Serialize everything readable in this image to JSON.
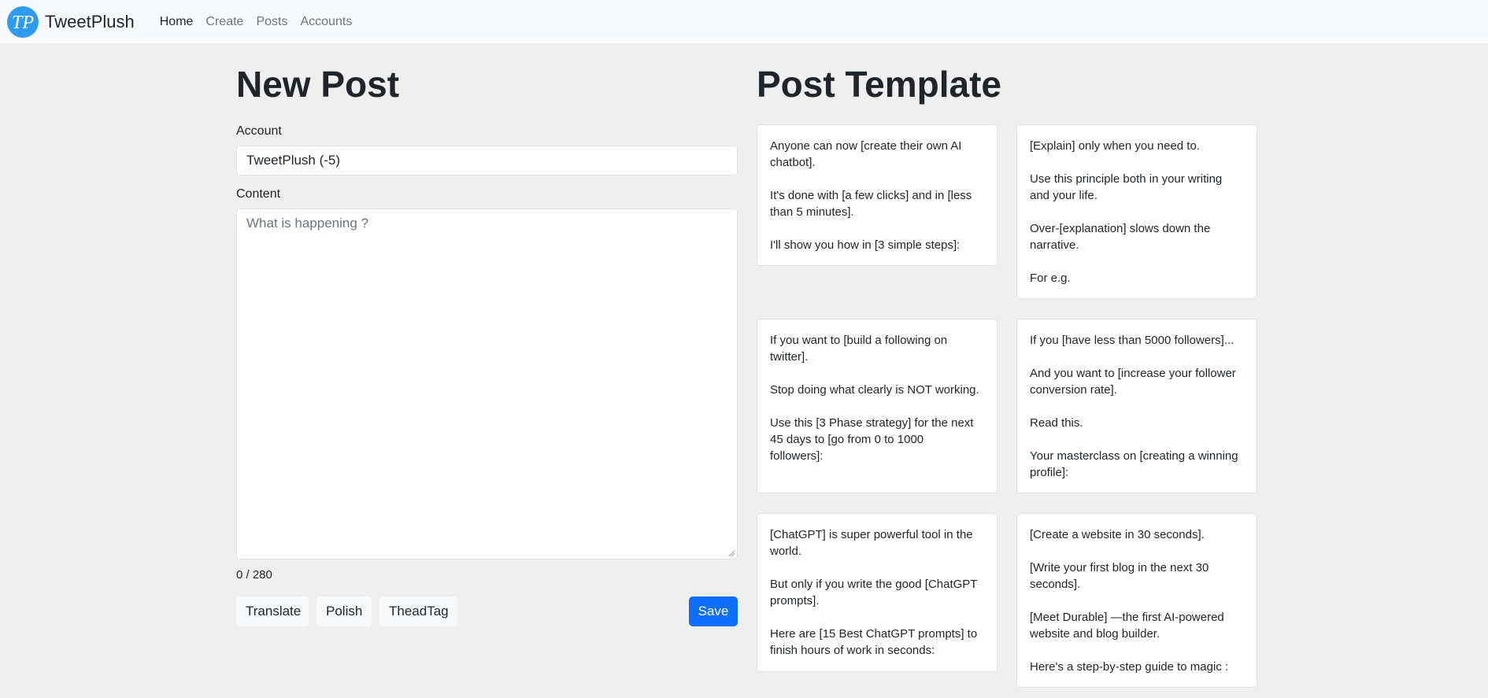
{
  "nav": {
    "logo_text": "TP",
    "brand": "TweetPlush",
    "links": [
      "Home",
      "Create",
      "Posts",
      "Accounts"
    ]
  },
  "new_post": {
    "title": "New Post",
    "account_label": "Account",
    "account_value": "TweetPlush (-5)",
    "content_label": "Content",
    "content_placeholder": "What is happening ?",
    "counter": "0 / 280",
    "buttons": {
      "translate": "Translate",
      "polish": "Polish",
      "threadtag": "TheadTag",
      "save": "Save"
    }
  },
  "template_section": {
    "title": "Post Template",
    "cards": [
      {
        "paragraphs": [
          "Anyone can now [create their own AI\nchatbot].",
          "It's done with [a few clicks] and in [less\nthan 5 minutes].",
          "I'll show you how in [3 simple steps]:"
        ]
      },
      {
        "paragraphs": [
          "[Explain] only when you need to.",
          "Use this principle both in your writing\nand your life.",
          "Over-[explanation] slows down the\nnarrative.",
          "For e.g."
        ]
      },
      {
        "paragraphs": [
          "If you want to [build a following on\ntwitter].",
          "Stop doing what clearly is NOT working.",
          "Use this [3 Phase strategy] for the next\n45 days to [go from 0 to 1000\nfollowers]:"
        ]
      },
      {
        "paragraphs": [
          "If you [have less than 5000 followers]...",
          "And you want to [increase your follower\nconversion rate].",
          "Read this.",
          "Your masterclass on [creating a winning\nprofile]:"
        ]
      },
      {
        "paragraphs": [
          "[ChatGPT] is super powerful tool in the\nworld.",
          "But only if you write the good [ChatGPT\nprompts].",
          "Here are [15 Best ChatGPT prompts] to\nfinish hours of work in seconds:"
        ]
      },
      {
        "paragraphs": [
          "[Create a website in 30 seconds].",
          "[Write your first blog in the next 30\nseconds].",
          "[Meet Durable] —the first AI-powered\nwebsite and blog builder.",
          "Here's a step-by-step guide to magic :"
        ]
      }
    ]
  },
  "colors": {
    "primary": "#0d6efd",
    "logo": "#2d9cf0",
    "background": "#efefef"
  }
}
